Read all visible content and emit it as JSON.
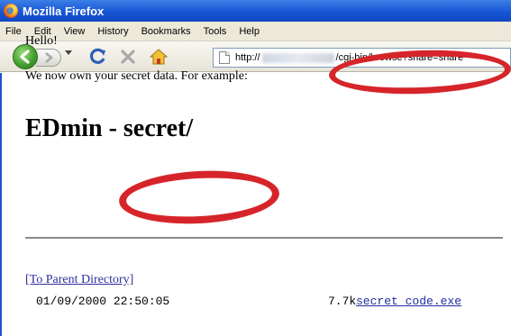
{
  "window": {
    "title": "Mozilla Firefox"
  },
  "menu": [
    "File",
    "Edit",
    "View",
    "History",
    "Bookmarks",
    "Tools",
    "Help"
  ],
  "address": {
    "prefix": "http://",
    "path": "/cgi-bin/browse?share=share"
  },
  "page": {
    "hello": "Hello!",
    "intro": "We now own your secret data. For example:",
    "heading": "EDmin - secret/",
    "parent_link": "[To Parent Directory]",
    "entries": [
      {
        "date": "01/09/2000 22:50:05",
        "size": "7.7k",
        "name": "secret code.exe"
      }
    ]
  },
  "colors": {
    "annotation": "#d6252a",
    "link": "#2f2f9f",
    "titlebar": "#1756d6"
  }
}
